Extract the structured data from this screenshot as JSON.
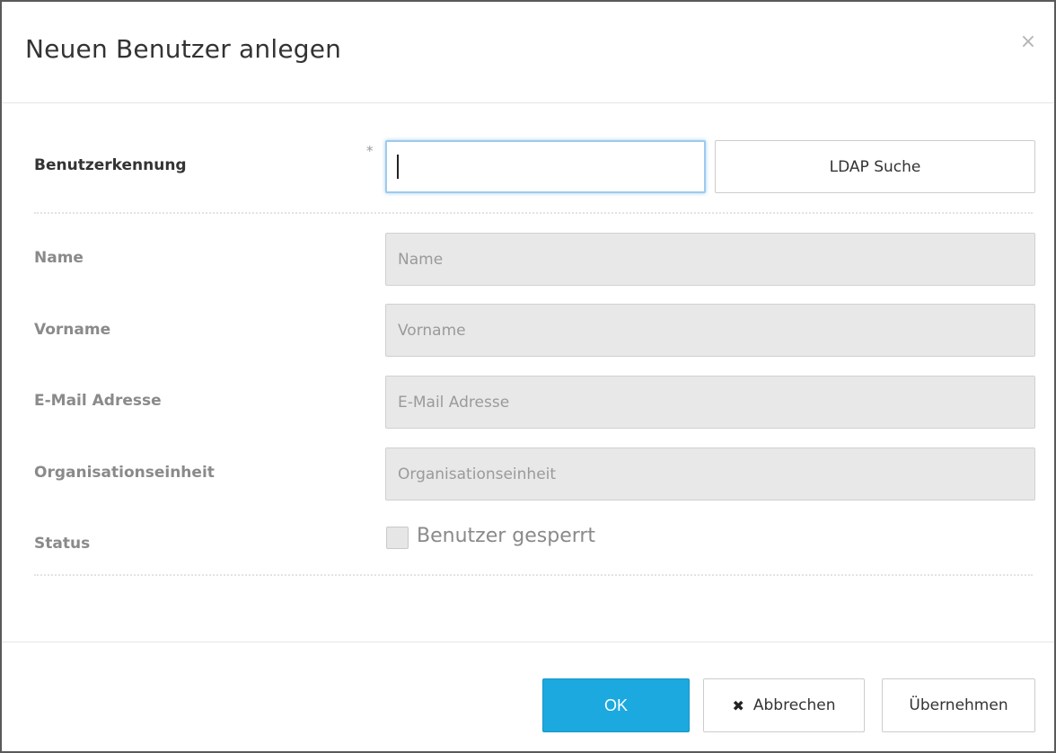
{
  "dialog": {
    "title": "Neuen Benutzer anlegen",
    "close_glyph": "×"
  },
  "form": {
    "user_id": {
      "label": "Benutzerkennung",
      "required_marker": "*",
      "value": ""
    },
    "ldap_button_label": "LDAP Suche",
    "name": {
      "label": "Name",
      "placeholder": "Name"
    },
    "firstname": {
      "label": "Vorname",
      "placeholder": "Vorname"
    },
    "email": {
      "label": "E-Mail Adresse",
      "placeholder": "E-Mail Adresse"
    },
    "org_unit": {
      "label": "Organisationseinheit",
      "placeholder": "Organisationseinheit"
    },
    "status": {
      "label": "Status",
      "checkbox_label": "Benutzer gesperrt",
      "checked": false
    }
  },
  "footer": {
    "ok_label": "OK",
    "cancel_label": "Abbrechen",
    "cancel_icon": "x-icon",
    "apply_label": "Übernehmen"
  },
  "colors": {
    "primary_button": "#1ba9df",
    "focus_border": "#9ecaed",
    "disabled_field": "#e8e8e8"
  }
}
